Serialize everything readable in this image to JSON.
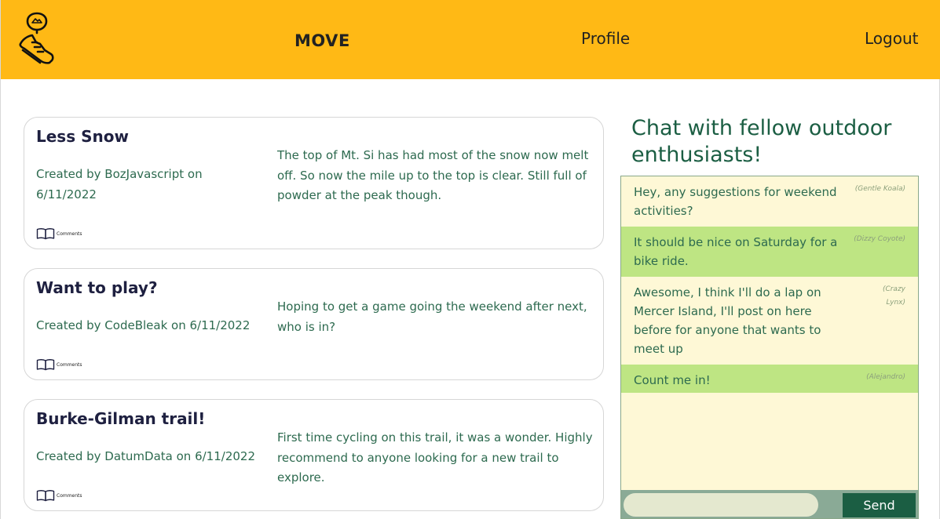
{
  "header": {
    "brand": "MOVE",
    "nav_profile": "Profile",
    "nav_logout": "Logout",
    "background_color": "#FFB915",
    "logo_icon": "running-shoe-location-pin-icon"
  },
  "posts": [
    {
      "title": "Less Snow",
      "meta": "Created by BozJavascript on 6/11/2022",
      "body": "The top of Mt. Si has had most of the snow now melt off. So now the mile up to the top is clear. Still full of powder at the peak though.",
      "comments_label": "Comments",
      "comments_icon": "open-book-icon"
    },
    {
      "title": "Want to play?",
      "meta": "Created by CodeBleak on 6/11/2022",
      "body": "Hoping to get a game going the weekend after next, who is in?",
      "comments_label": "Comments",
      "comments_icon": "open-book-icon"
    },
    {
      "title": "Burke-Gilman trail!",
      "meta": "Created by DatumData on 6/11/2022",
      "body": "First time cycling on this trail, it was a wonder. Highly recommend to anyone looking for a new trail to explore.",
      "comments_label": "Comments",
      "comments_icon": "open-book-icon"
    }
  ],
  "chat": {
    "heading": "Chat with fellow outdoor enthusiasts!",
    "messages": [
      {
        "text": "Hey, any suggestions for weekend activities?",
        "author": "(Gentle Koala)"
      },
      {
        "text": "It should be nice on Saturday for a bike ride.",
        "author": "(Dizzy Coyote)"
      },
      {
        "text": "Awesome, I think I'll do a lap on Mercer Island, I'll post on here before for anyone that wants to meet up",
        "author": "(Crazy Lynx)"
      },
      {
        "text": "Count me in!",
        "author": "(Alejandro)"
      }
    ],
    "input_value": "",
    "send_label": "Send",
    "colors": {
      "panel": "#FEF8D6",
      "alt_message": "#BEE583",
      "send_button": "#1B5E43"
    }
  }
}
